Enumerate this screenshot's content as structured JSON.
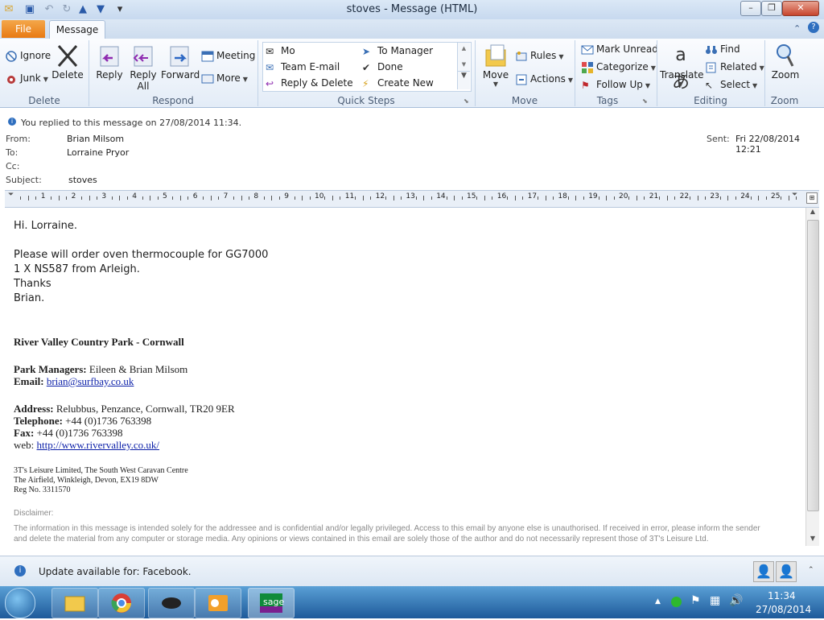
{
  "window": {
    "title": "stoves  -  Message (HTML)"
  },
  "tabs": {
    "file": "File",
    "message": "Message"
  },
  "ribbon": {
    "delete_group": {
      "label": "Delete",
      "ignore": "Ignore",
      "junk": "Junk",
      "delete": "Delete"
    },
    "respond_group": {
      "label": "Respond",
      "reply": "Reply",
      "reply_all": "Reply All",
      "forward": "Forward",
      "meeting": "Meeting",
      "more": "More"
    },
    "quick_steps": {
      "label": "Quick Steps",
      "items": [
        "Mo",
        "To Manager",
        "Team E-mail",
        "Done",
        "Reply & Delete",
        "Create New"
      ]
    },
    "move_group": {
      "label": "Move",
      "move": "Move",
      "rules": "Rules",
      "actions": "Actions"
    },
    "tags_group": {
      "label": "Tags",
      "mark_unread": "Mark Unread",
      "categorize": "Categorize",
      "follow_up": "Follow Up"
    },
    "editing_group": {
      "label": "Editing",
      "translate": "Translate",
      "find": "Find",
      "related": "Related",
      "select": "Select"
    },
    "zoom_group": {
      "label": "Zoom",
      "zoom": "Zoom"
    }
  },
  "info_bar": "You replied to this message on 27/08/2014 11:34.",
  "header": {
    "from_label": "From:",
    "from": "Brian Milsom",
    "to_label": "To:",
    "to": "Lorraine Pryor",
    "cc_label": "Cc:",
    "cc": "",
    "subject_label": "Subject:",
    "subject": "stoves",
    "sent_label": "Sent:",
    "sent": "Fri 22/08/2014 12:21"
  },
  "ruler_numbers": [
    "1",
    "2",
    "3",
    "4",
    "5",
    "6",
    "7",
    "8",
    "9",
    "10",
    "11",
    "12",
    "13",
    "14",
    "15",
    "16",
    "17",
    "18",
    "19",
    "20",
    "21",
    "22",
    "23",
    "24",
    "25"
  ],
  "body": {
    "greeting": "Hi. Lorraine.",
    "line1": "Please will order oven thermocouple for GG7000",
    "line2": "1 X NS587 from Arleigh.",
    "line3": "Thanks",
    "line4": "Brian.",
    "sig_title": "River Valley Country Park - Cornwall",
    "managers_label": "Park Managers:",
    "managers": "Eileen & Brian Milsom",
    "email_label": "Email:",
    "email": "brian@surfbay.co.uk",
    "address_label": "Address:",
    "address": "Relubbus, Penzance, Cornwall, TR20 9ER",
    "telephone_label": "Telephone:",
    "telephone": "+44 (0)1736 763398",
    "fax_label": "Fax:",
    "fax": "+44 (0)1736 763398",
    "web_label": "web:",
    "web": "http://www.rivervalley.co.uk/",
    "company1": "3T's Leisure Limited, The South West Caravan Centre",
    "company2": "The Airfield, Winkleigh, Devon, EX19 8DW",
    "company3": "Reg No. 3311570",
    "disclaimer_label": "Disclaimer:",
    "disclaimer1": "The information in this message is intended solely for the addressee and is confidential and/or legally privileged. Access to this email by anyone else is unauthorised. If received in error, please inform the sender",
    "disclaimer2": "and delete the material from any computer or storage media. Any opinions or views contained in this email are solely those of the author and do not necessarily represent those of  3T's Leisure Ltd."
  },
  "people_pane": {
    "update": "Update available for: Facebook."
  },
  "taskbar": {
    "time": "11:34",
    "date": "27/08/2014"
  }
}
